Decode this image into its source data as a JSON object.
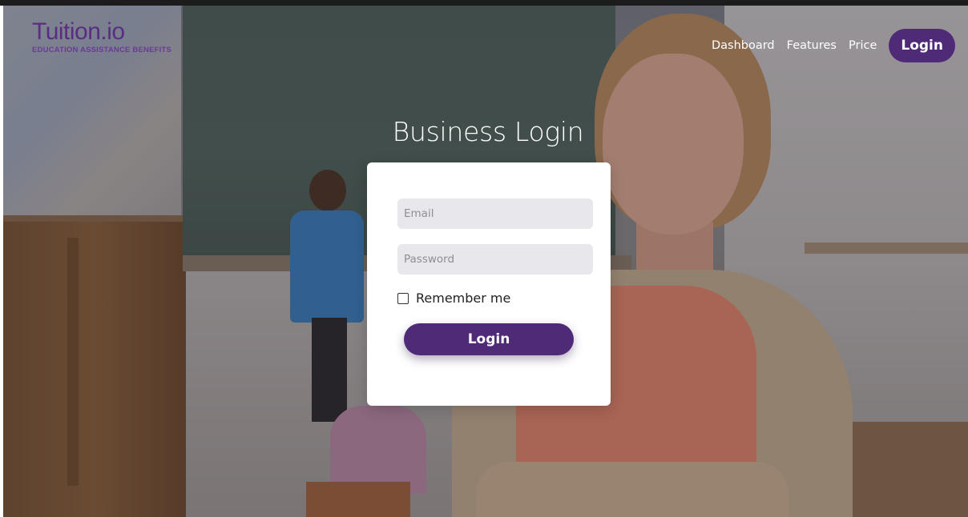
{
  "brand": {
    "name": "Tuition.io",
    "tagline": "EDUCATION ASSISTANCE BENEFITS",
    "color": "#5a2d82"
  },
  "nav": {
    "links": [
      "Dashboard",
      "Features",
      "Price"
    ],
    "login_label": "Login"
  },
  "login": {
    "title": "Business Login",
    "email_placeholder": "Email",
    "password_placeholder": "Password",
    "remember_label": "Remember me",
    "remember_checked": false,
    "submit_label": "Login"
  },
  "colors": {
    "accent": "#4e2a77",
    "field_bg": "#e8e8ec",
    "card_bg": "#ffffff"
  }
}
